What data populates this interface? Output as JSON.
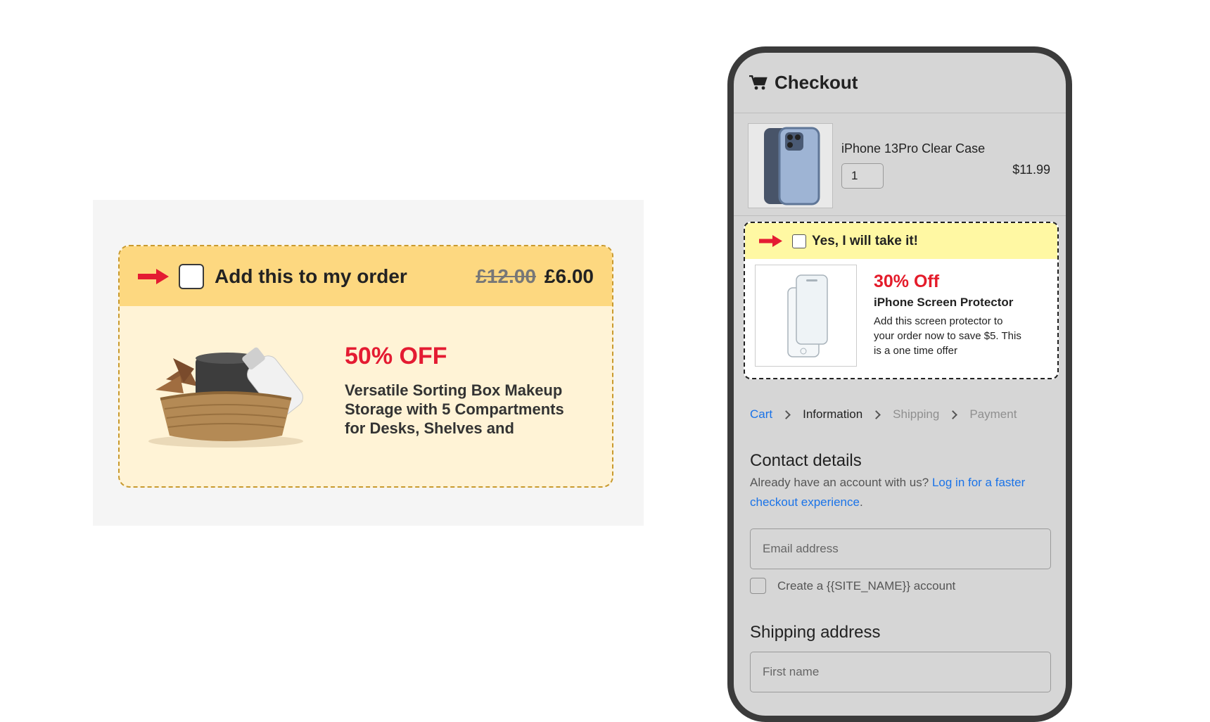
{
  "promo_offer": {
    "title": "Add this to my order",
    "old_price": "£12.00",
    "new_price": "£6.00",
    "discount": "50% OFF",
    "description": "Versatile Sorting Box Makeup Storage with 5 Compartments for Desks, Shelves and",
    "accent_color": "#e41b32"
  },
  "checkout": {
    "title": "Checkout",
    "product": {
      "name": "iPhone 13Pro Clear Case",
      "quantity": "1",
      "price": "$11.99"
    },
    "upsell": {
      "label": "Yes, I will take it!",
      "discount": "30% Off",
      "name": "iPhone Screen Protector",
      "description": "Add this screen protector to your order now to save $5. This is a one time offer"
    },
    "breadcrumb": {
      "cart": "Cart",
      "information": "Information",
      "shipping": "Shipping",
      "payment": "Payment"
    },
    "contact": {
      "title": "Contact details",
      "prompt": "Already have an account with us?",
      "login_link": "Log in for a faster checkout experience",
      "email_placeholder": "Email address",
      "create_account_label": "Create a {{SITE_NAME}} account"
    },
    "shipping": {
      "title": "Shipping address",
      "first_name_placeholder": "First name"
    }
  }
}
